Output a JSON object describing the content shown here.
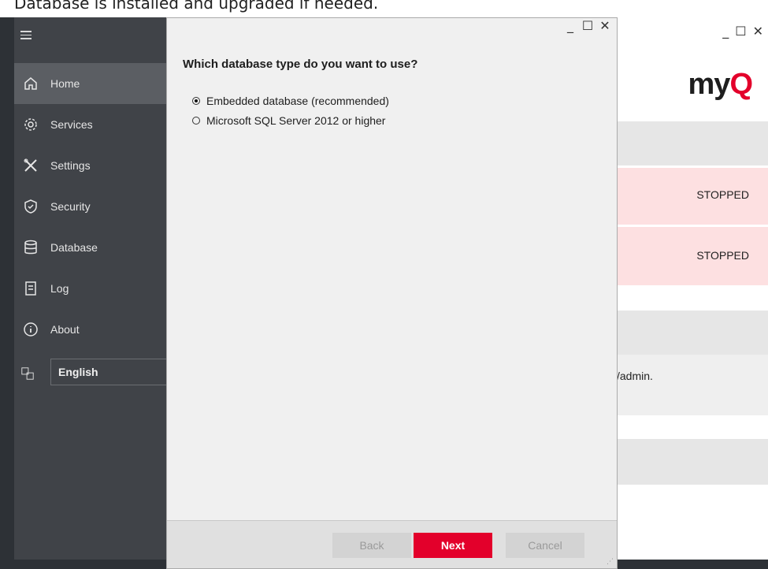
{
  "top_strip": {
    "text": "Database is installed and upgraded if needed."
  },
  "sidebar": {
    "items": [
      {
        "label": "Home",
        "icon": "home-icon"
      },
      {
        "label": "Services",
        "icon": "gear-icon"
      },
      {
        "label": "Settings",
        "icon": "tools-icon"
      },
      {
        "label": "Security",
        "icon": "shield-icon"
      },
      {
        "label": "Database",
        "icon": "database-icon"
      },
      {
        "label": "Log",
        "icon": "log-icon"
      },
      {
        "label": "About",
        "icon": "info-icon"
      }
    ],
    "language": {
      "value": "English",
      "icon": "language-icon"
    }
  },
  "main": {
    "logo": {
      "my": "my",
      "q": "Q"
    },
    "rows": [
      {
        "status": "STOPPED"
      },
      {
        "status": "STOPPED"
      }
    ],
    "admin_text": "/admin."
  },
  "dialog": {
    "question": "Which database type do you want to use?",
    "options": [
      {
        "label": "Embedded database (recommended)",
        "checked": true
      },
      {
        "label": "Microsoft SQL Server 2012 or higher",
        "checked": false
      }
    ],
    "buttons": {
      "back": "Back",
      "next": "Next",
      "cancel": "Cancel"
    }
  },
  "colors": {
    "accent": "#e3002b",
    "sidebar": "#404348",
    "error_band": "#fde0e1"
  }
}
